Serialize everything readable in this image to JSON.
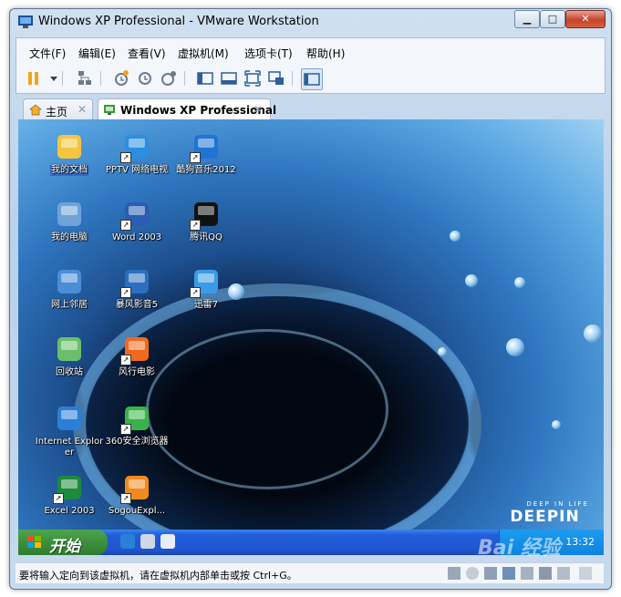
{
  "window": {
    "title": "Windows XP Professional - VMware Workstation",
    "minimize_label": "▁",
    "maximize_label": "□",
    "close_label": "✕"
  },
  "menu": {
    "items": [
      "文件(F)",
      "编辑(E)",
      "查看(V)",
      "虚拟机(M)",
      "选项卡(T)",
      "帮助(H)"
    ]
  },
  "toolbar": {
    "icons": [
      "pause-icon",
      "dropdown-icon",
      "network-icon",
      "snapshot-icon",
      "revert-snapshot-icon",
      "snapshot-manager-icon",
      "console-view-icon",
      "quick-switch-icon",
      "fullscreen-icon",
      "unity-icon",
      "library-view-icon"
    ]
  },
  "tabs": [
    {
      "label": "主页",
      "close": "✕"
    },
    {
      "label": "Windows XP Professional",
      "close": "✕"
    }
  ],
  "desktop": {
    "icons": [
      {
        "label": "我的文档",
        "name": "my-documents-icon",
        "shortcut": false,
        "selected": true,
        "color": "#f4c542"
      },
      {
        "label": "PPTV 网络电视",
        "name": "pptv-icon",
        "shortcut": true,
        "selected": false,
        "color": "#2b8ee0"
      },
      {
        "label": "酷狗音乐2012",
        "name": "kugou-icon",
        "shortcut": true,
        "selected": false,
        "color": "#1f74d6"
      },
      {
        "label": "我的电脑",
        "name": "my-computer-icon",
        "shortcut": false,
        "selected": false,
        "color": "#6fa3d8"
      },
      {
        "label": "Word 2003",
        "name": "word-icon",
        "shortcut": true,
        "selected": false,
        "color": "#2a5db3"
      },
      {
        "label": "腾讯QQ",
        "name": "qq-icon",
        "shortcut": true,
        "selected": false,
        "color": "#111111"
      },
      {
        "label": "网上邻居",
        "name": "network-places-icon",
        "shortcut": false,
        "selected": false,
        "color": "#4b8dd6"
      },
      {
        "label": "暴风影音5",
        "name": "baofeng-icon",
        "shortcut": true,
        "selected": false,
        "color": "#2c6fc0"
      },
      {
        "label": "迅雷7",
        "name": "xunlei-icon",
        "shortcut": true,
        "selected": false,
        "color": "#3a9be8"
      },
      {
        "label": "回收站",
        "name": "recycle-bin-icon",
        "shortcut": false,
        "selected": false,
        "color": "#6ac06a"
      },
      {
        "label": "风行电影",
        "name": "funshion-icon",
        "shortcut": true,
        "selected": false,
        "color": "#f06a1e"
      },
      {
        "label": "Internet Explorer",
        "name": "internet-explorer-icon",
        "shortcut": false,
        "selected": false,
        "color": "#2a7fd6"
      },
      {
        "label": "360安全浏览器",
        "name": "360-browser-icon",
        "shortcut": true,
        "selected": false,
        "color": "#38b34a"
      },
      {
        "label": "Excel 2003",
        "name": "excel-icon",
        "shortcut": true,
        "selected": false,
        "color": "#1e8a3c"
      },
      {
        "label": "SogouExpl...",
        "name": "sogou-explorer-icon",
        "shortcut": true,
        "selected": false,
        "color": "#f08a1e"
      }
    ]
  },
  "deepin": {
    "sub": "DEEP IN LIFE",
    "word": "DEEPIN"
  },
  "taskbar": {
    "start_label": "开始",
    "time": "13:32"
  },
  "watermark": "Bai 经验",
  "status": {
    "text": "要将输入定向到该虚拟机，请在虚拟机内部单击或按 Ctrl+G。"
  }
}
